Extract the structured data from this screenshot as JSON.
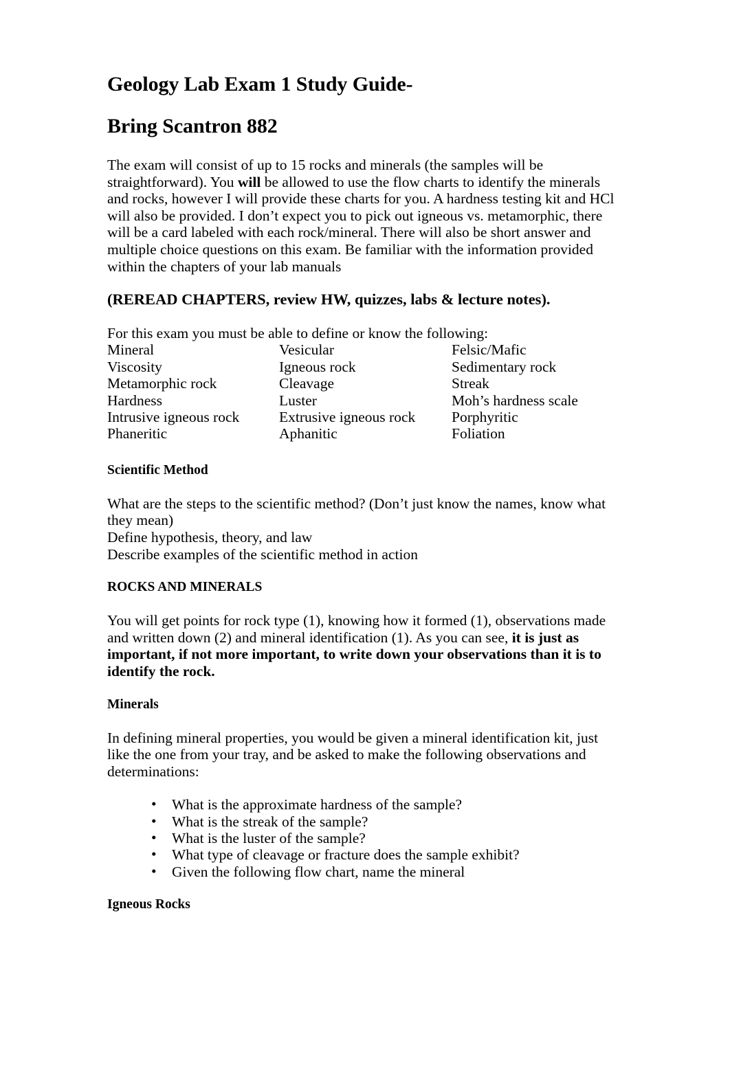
{
  "document": {
    "title_line_1": "Geology Lab Exam 1 Study Guide-",
    "title_line_2": "Bring Scantron 882",
    "intro_paragraph": {
      "part_1": "The exam will consist of up to 15 rocks and minerals (the samples will be straightforward). You ",
      "emphasis_1": "will",
      "part_2": " be allowed to use the flow charts to identify the minerals and rocks, however I will provide these charts for you. A hardness testing kit and HCl will also be provided. I don’t expect you to pick out igneous vs. metamorphic, there will be a card labeled with each rock/mineral. There will also be short answer and multiple choice questions on this exam. Be familiar with the information provided within the chapters of your lab manuals"
    },
    "callout": "(REREAD CHAPTERS, review HW, quizzes, labs & lecture notes).",
    "terms_intro": "For this exam you must be able to define or know the following:",
    "terms": {
      "column_1": [
        "Mineral",
        "Viscosity",
        "Metamorphic rock",
        "Hardness",
        "Intrusive igneous rock",
        "Phaneritic"
      ],
      "column_2": [
        "Vesicular",
        "Igneous rock",
        "Cleavage",
        "Luster",
        "Extrusive igneous rock",
        "Aphanitic"
      ],
      "column_3": [
        "Felsic/Mafic",
        "Sedimentary rock",
        "Streak",
        "Moh’s hardness scale",
        "Porphyritic",
        "Foliation"
      ]
    },
    "sections": [
      {
        "heading": "Scientific Method",
        "lines": [
          "What are the steps to the scientific method? (Don’t just know the names, know what they mean)",
          "Define hypothesis, theory, and law",
          "Describe examples of the scientific method in action"
        ]
      },
      {
        "heading": "ROCKS AND MINERALS",
        "paragraph": {
          "part_1": "You will get points for rock type (1), knowing how it formed (1), observations made and written down (2) and mineral identification (1). As you can see, ",
          "emphasis_1": "it is just as important, if not more important, to write down your observations than it is to identify the rock."
        }
      },
      {
        "heading": "Minerals",
        "paragraph": "In defining mineral properties, you would be given a mineral identification kit, just like the one from your tray, and be asked to make the following observations and determinations:",
        "bullets": [
          "What is the approximate hardness of the sample?",
          "What is the streak of the sample?",
          "What is the luster of the sample?",
          "What type of cleavage or fracture does the sample exhibit?",
          "Given the following flow chart, name the mineral"
        ],
        "bullet_glyph": "•"
      },
      {
        "heading": "Igneous Rocks"
      }
    ]
  }
}
